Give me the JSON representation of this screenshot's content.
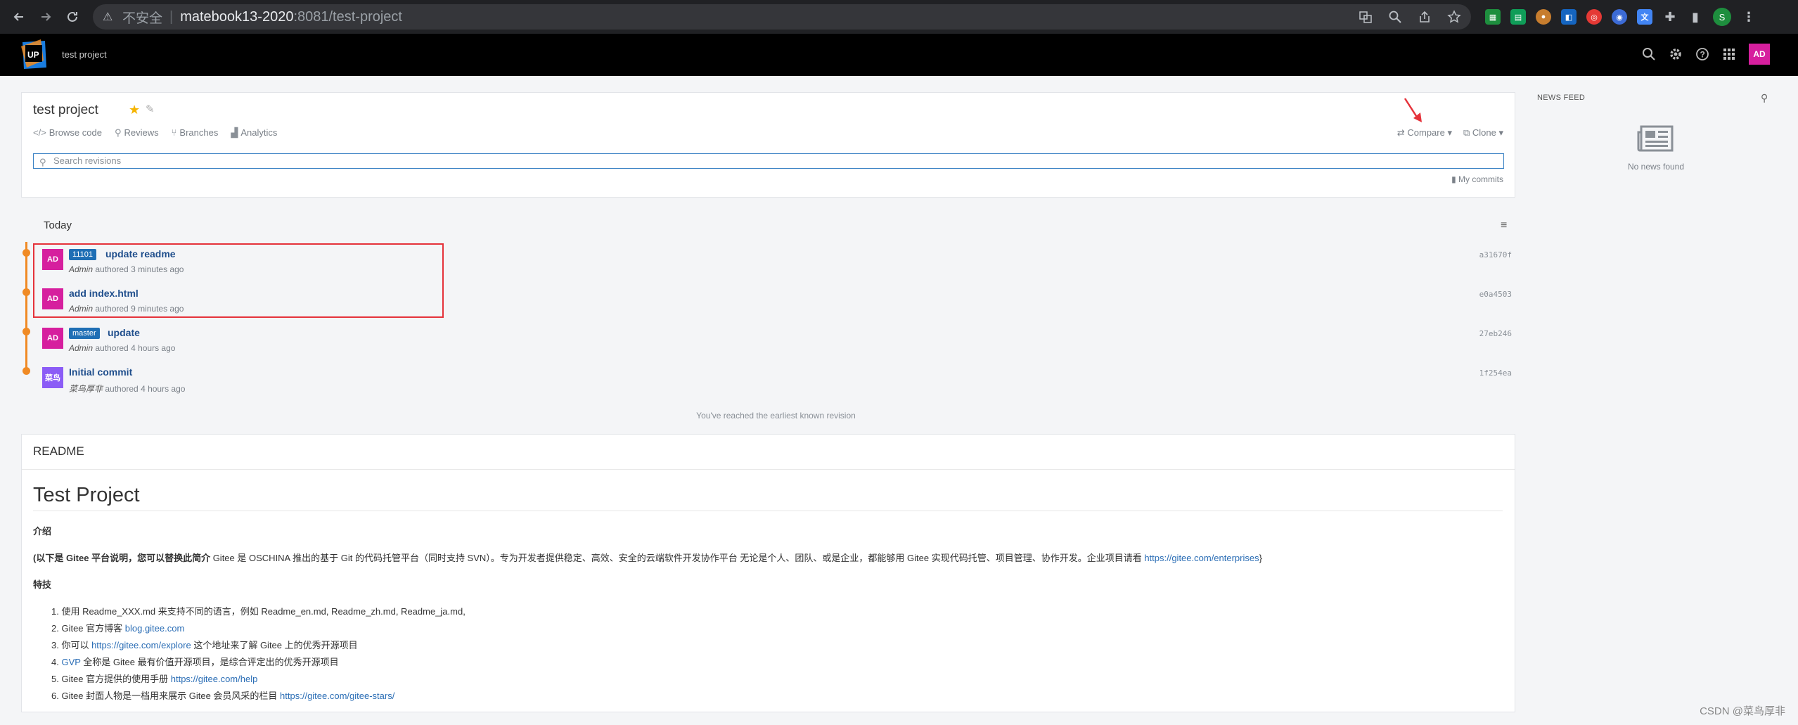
{
  "browser": {
    "security_label": "不安全",
    "url_host": "matebook13-2020",
    "url_path": ":8081/test-project",
    "profile_initial": "S"
  },
  "header": {
    "logo_text": "UP",
    "project_crumb": "test project",
    "avatar_initials": "AD"
  },
  "project": {
    "title": "test project",
    "nav": [
      "Browse code",
      "Reviews",
      "Branches",
      "Analytics"
    ],
    "compare_label": "Compare",
    "clone_label": "Clone",
    "search_placeholder": "Search revisions",
    "my_commits_label": "My commits"
  },
  "history": {
    "group_label": "Today",
    "commits": [
      {
        "avatar": "AD",
        "tag": "11101",
        "message": "update readme",
        "author": "Admin",
        "time": "authored 3 minutes ago",
        "hash": "a31670f"
      },
      {
        "avatar": "AD",
        "tag": "",
        "message": "add index.html",
        "author": "Admin",
        "time": "authored 9 minutes ago",
        "hash": "e0a4503"
      },
      {
        "avatar": "AD",
        "tag": "master",
        "message": "update",
        "author": "Admin",
        "time": "authored 4 hours ago",
        "hash": "27eb246"
      },
      {
        "avatar": "菜鸟",
        "tag": "",
        "message": "Initial commit",
        "author": "菜鸟厚非",
        "time": "authored 4 hours ago",
        "hash": "1f254ea"
      }
    ],
    "earliest_note": "You've reached the earliest known revision"
  },
  "readme": {
    "header": "README",
    "title": "Test Project",
    "intro_heading": "介绍",
    "intro_bold": "(以下是 Gitee 平台说明，您可以替换此简介",
    "intro_text": " Gitee 是 OSCHINA 推出的基于 Git 的代码托管平台（同时支持 SVN）。专为开发者提供稳定、高效、安全的云端软件开发协作平台 无论是个人、团队、或是企业，都能够用 Gitee 实现代码托管、项目管理、协作开发。企业项目请看 ",
    "intro_link": "https://gitee.com/enterprises",
    "intro_end": "}",
    "features_heading": "特技",
    "items": [
      {
        "pre": "1. 使用 Readme_XXX.md 来支持不同的语言，例如 Readme_en.md, Readme_zh.md, Readme_ja.md,",
        "link": "",
        "post": ""
      },
      {
        "pre": "2. Gitee 官方博客 ",
        "link": "blog.gitee.com",
        "post": ""
      },
      {
        "pre": "3. 你可以 ",
        "link": "https://gitee.com/explore",
        "post": " 这个地址来了解 Gitee 上的优秀开源项目"
      },
      {
        "pre": "4. ",
        "link": "GVP",
        "post": " 全称是 Gitee 最有价值开源项目，是综合评定出的优秀开源项目"
      },
      {
        "pre": "5. Gitee 官方提供的使用手册 ",
        "link": "https://gitee.com/help",
        "post": ""
      },
      {
        "pre": "6. Gitee 封面人物是一档用来展示 Gitee 会员风采的栏目 ",
        "link": "https://gitee.com/gitee-stars/",
        "post": ""
      }
    ]
  },
  "news": {
    "label": "NEWS FEED",
    "empty": "No news found"
  },
  "watermark": "CSDN @菜鸟厚非"
}
